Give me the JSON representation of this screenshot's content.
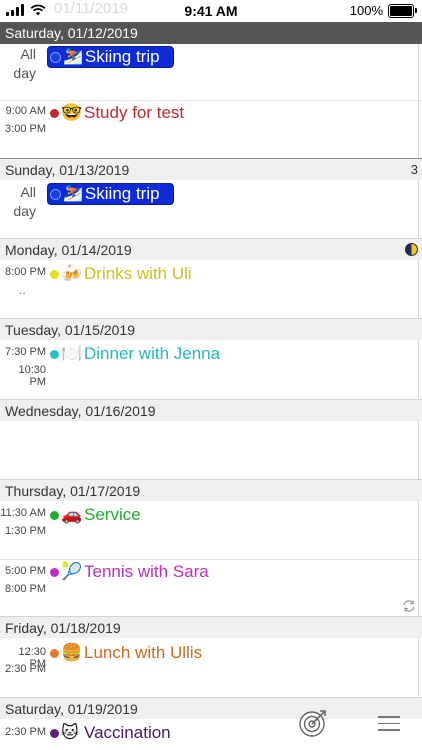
{
  "status": {
    "ghost_date": "01/11/2019",
    "time": "9:41 AM",
    "battery": "100%"
  },
  "days": [
    {
      "title": "Saturday, 01/12/2019",
      "events": [
        {
          "allday": "All day",
          "title": "Skiing trip",
          "emoji": "⛷️",
          "color": "#0d2bd8"
        },
        {
          "start": "9:00 AM",
          "end": "3:00 PM",
          "title": "Study for test",
          "emoji": "🤓",
          "color": "#c0282d"
        }
      ]
    },
    {
      "title": "Sunday, 01/13/2019",
      "count": "3",
      "events": [
        {
          "allday": "All day",
          "title": "Skiing trip",
          "emoji": "⛷️",
          "color": "#0d2bd8"
        }
      ]
    },
    {
      "title": "Monday, 01/14/2019",
      "events": [
        {
          "start": "8:00 PM",
          "end": "..",
          "title": "Drinks with Uli",
          "emoji": "🍻",
          "color": "#c9c21a"
        }
      ]
    },
    {
      "title": "Tuesday, 01/15/2019",
      "events": [
        {
          "start": "7:30 PM",
          "end": "10:30 PM",
          "title": "Dinner with Jenna",
          "emoji": "🍽️",
          "color": "#22c2c9"
        }
      ]
    },
    {
      "title": "Wednesday, 01/16/2019",
      "events": []
    },
    {
      "title": "Thursday, 01/17/2019",
      "events": [
        {
          "start": "11:30 AM",
          "end": "1:30 PM",
          "title": "Service",
          "emoji": "🚗",
          "color": "#1fae2a"
        },
        {
          "start": "5:00 PM",
          "end": "8:00 PM",
          "title": "Tennis with Sara",
          "emoji": "🎾",
          "color": "#c12bc4"
        }
      ]
    },
    {
      "title": "Friday, 01/18/2019",
      "events": [
        {
          "start": "12:30 PM",
          "end": "2:30 PM",
          "title": "Lunch with Ullis",
          "emoji": "🍔",
          "color": "#d2691e"
        }
      ]
    },
    {
      "title": "Saturday, 01/19/2019",
      "events": [
        {
          "start": "2:30 PM",
          "title": "Vaccination",
          "emoji": "🐱",
          "color": "#5b1e7a"
        }
      ]
    }
  ]
}
